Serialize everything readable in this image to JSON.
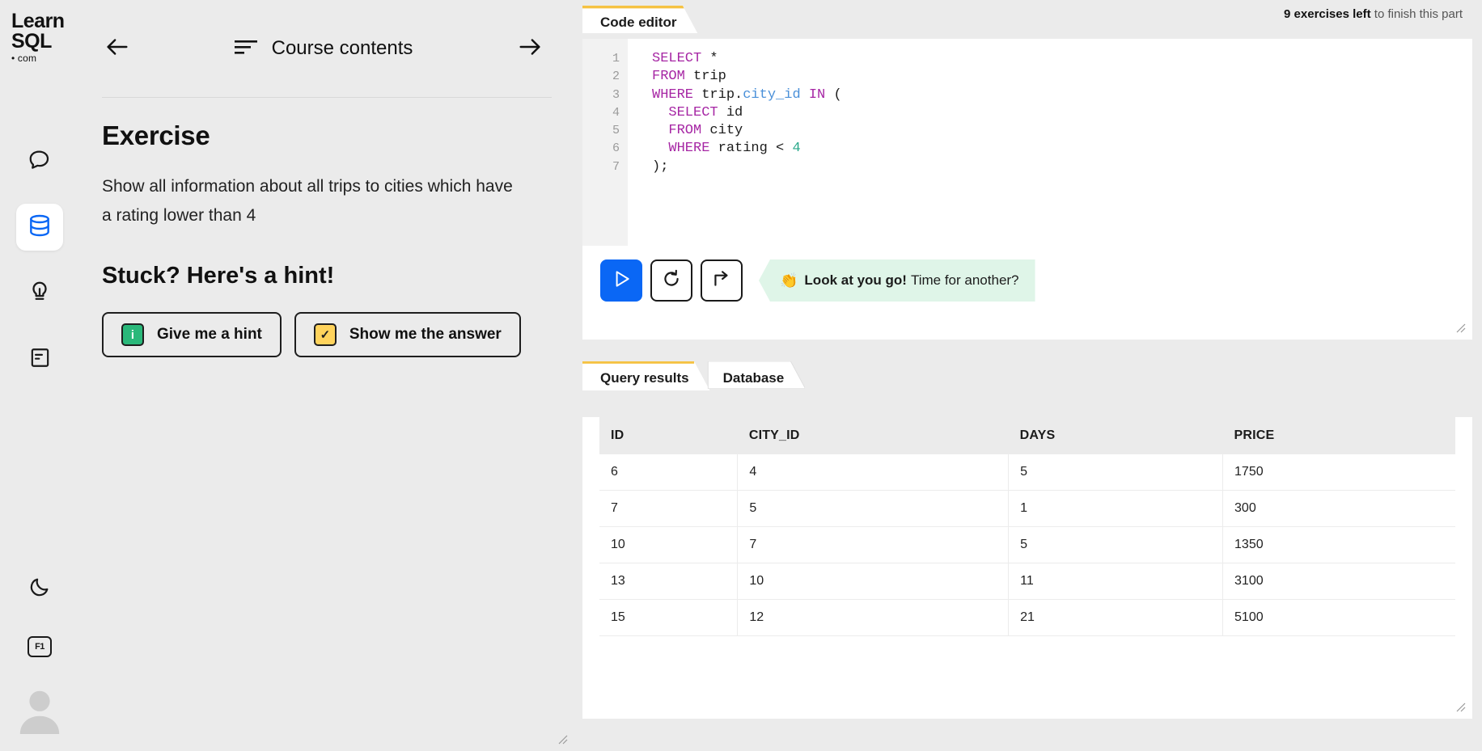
{
  "brand": {
    "line1": "Learn",
    "line2": "SQL",
    "line3": "• com"
  },
  "sidebar": {
    "items": [
      {
        "name": "discussion",
        "icon": "chat-bubble-icon",
        "active": false
      },
      {
        "name": "database",
        "icon": "database-icon",
        "active": true
      },
      {
        "name": "hints",
        "icon": "lightbulb-icon",
        "active": false
      },
      {
        "name": "notes",
        "icon": "document-icon",
        "active": false
      }
    ],
    "bottom": [
      {
        "name": "dark-mode",
        "icon": "moon-icon"
      },
      {
        "name": "shortcuts",
        "icon": "f1-key-icon",
        "label": "F1"
      },
      {
        "name": "account",
        "icon": "avatar-icon"
      }
    ]
  },
  "course": {
    "prev_label": "←",
    "next_label": "→",
    "title": "Course contents"
  },
  "exercise": {
    "heading": "Exercise",
    "text": "Show all information about all trips to cities which have a rating lower than 4",
    "hint_heading": "Stuck? Here's a hint!",
    "hint_button": "Give me a hint",
    "answer_button": "Show me the answer",
    "hint_icon_glyph": "i",
    "answer_icon_glyph": "✓"
  },
  "header": {
    "exercises_left_bold": "9 exercises left",
    "exercises_left_rest": " to finish this part"
  },
  "editor": {
    "tab_label": "Code editor",
    "accent_color": "#f5c242",
    "line_numbers": [
      "1",
      "2",
      "3",
      "4",
      "5",
      "6",
      "7"
    ],
    "code_lines": [
      [
        {
          "t": "SELECT",
          "c": "kw"
        },
        {
          "t": " *",
          "c": ""
        }
      ],
      [
        {
          "t": "FROM",
          "c": "kw"
        },
        {
          "t": " trip",
          "c": ""
        }
      ],
      [
        {
          "t": "WHERE",
          "c": "kw"
        },
        {
          "t": " trip.",
          "c": ""
        },
        {
          "t": "city_id",
          "c": "col"
        },
        {
          "t": " ",
          "c": ""
        },
        {
          "t": "IN",
          "c": "kw"
        },
        {
          "t": " (",
          "c": ""
        }
      ],
      [
        {
          "t": "  SELECT",
          "c": "kw"
        },
        {
          "t": " id",
          "c": ""
        }
      ],
      [
        {
          "t": "  FROM",
          "c": "kw"
        },
        {
          "t": " city",
          "c": ""
        }
      ],
      [
        {
          "t": "  WHERE",
          "c": "kw"
        },
        {
          "t": " rating < ",
          "c": ""
        },
        {
          "t": "4",
          "c": "num"
        }
      ],
      [
        {
          "t": ");",
          "c": ""
        }
      ]
    ]
  },
  "toolbar": {
    "run_label": "run-query",
    "reset_label": "reset-code",
    "next_label": "next-exercise",
    "success_emoji": "👏",
    "success_bold": "Look at you go!",
    "success_rest": "Time for another?",
    "success_bg": "#dff5e8"
  },
  "results": {
    "tabs": [
      {
        "label": "Query results",
        "active": true
      },
      {
        "label": "Database",
        "active": false
      }
    ],
    "columns": [
      "ID",
      "CITY_ID",
      "DAYS",
      "PRICE"
    ],
    "rows": [
      [
        "6",
        "4",
        "5",
        "1750"
      ],
      [
        "7",
        "5",
        "1",
        "300"
      ],
      [
        "10",
        "7",
        "5",
        "1350"
      ],
      [
        "13",
        "10",
        "11",
        "3100"
      ],
      [
        "15",
        "12",
        "21",
        "5100"
      ]
    ]
  }
}
